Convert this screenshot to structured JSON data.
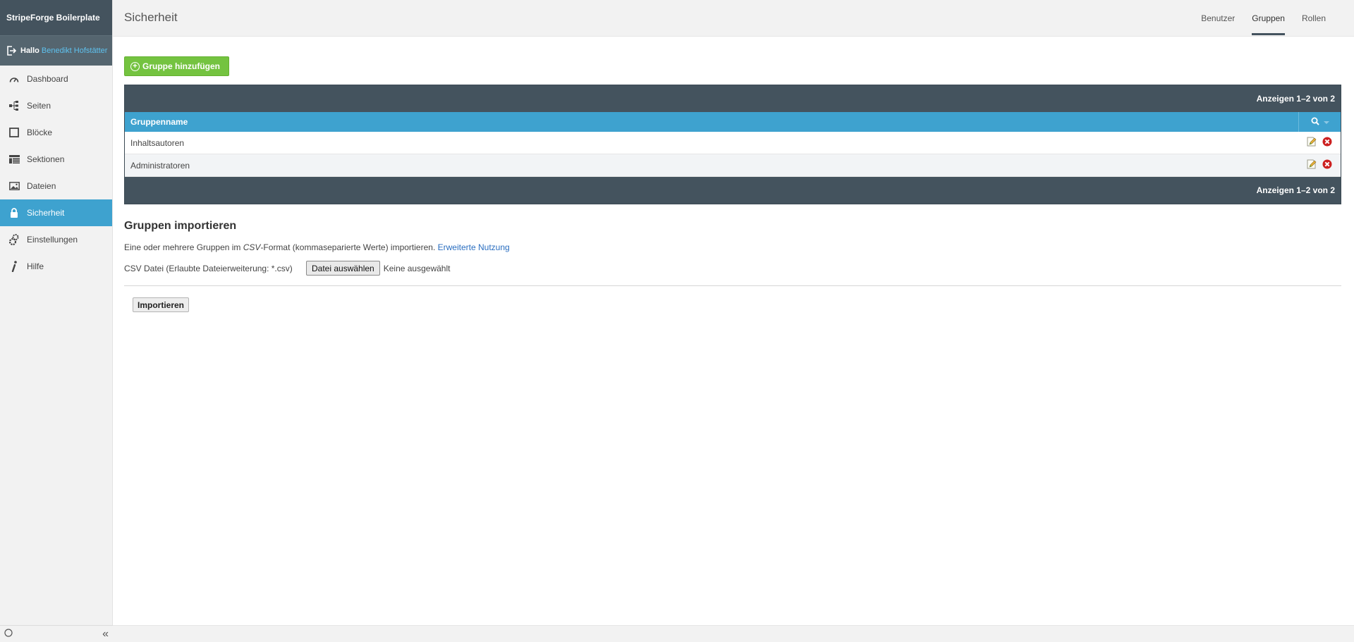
{
  "app": {
    "brand": "StripeForge Boilerplate"
  },
  "user": {
    "greeting": "Hallo",
    "name": "Benedikt Hofstätter"
  },
  "sidebar": {
    "items": [
      {
        "label": "Dashboard",
        "icon": "gauge-icon"
      },
      {
        "label": "Seiten",
        "icon": "sitemap-icon"
      },
      {
        "label": "Blöcke",
        "icon": "square-icon"
      },
      {
        "label": "Sektionen",
        "icon": "layout-icon"
      },
      {
        "label": "Dateien",
        "icon": "image-icon"
      },
      {
        "label": "Sicherheit",
        "icon": "lock-icon",
        "active": true
      },
      {
        "label": "Einstellungen",
        "icon": "gears-icon"
      },
      {
        "label": "Hilfe",
        "icon": "info-icon"
      }
    ],
    "collapse_label": "«"
  },
  "header": {
    "title": "Sicherheit",
    "tabs": [
      {
        "label": "Benutzer"
      },
      {
        "label": "Gruppen",
        "active": true
      },
      {
        "label": "Rollen"
      }
    ]
  },
  "main": {
    "add_button_label": "Gruppe hinzufügen",
    "grid": {
      "pager_text_top": "Anzeigen 1–2 von 2",
      "pager_text_bottom": "Anzeigen 1–2 von 2",
      "column_header": "Gruppenname",
      "rows": [
        {
          "name": "Inhaltsautoren"
        },
        {
          "name": "Administratoren"
        }
      ]
    },
    "import": {
      "title": "Gruppen importieren",
      "desc_before": "Eine oder mehrere Gruppen im ",
      "desc_format": "CSV",
      "desc_after": "-Format (kommaseparierte Werte) importieren. ",
      "desc_link": "Erweiterte Nutzung",
      "file_label": "CSV Datei (Erlaubte Dateierweiterung: *.csv)",
      "file_button": "Datei auswählen",
      "file_status": "Keine ausgewählt",
      "submit_label": "Importieren"
    }
  },
  "colors": {
    "sidebar_dark": "#44535e",
    "accent_blue": "#3ea2cf",
    "add_green": "#74c340",
    "delete_red": "#cc1f1f"
  }
}
